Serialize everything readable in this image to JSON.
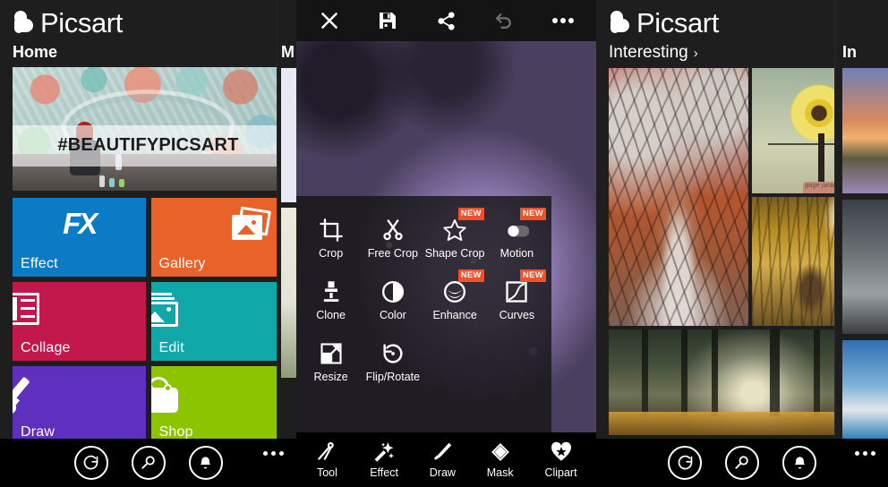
{
  "brand": {
    "name": "Picsart"
  },
  "home": {
    "section_title": "Home",
    "banner": {
      "caption": "#BEAUTIFYPICSART"
    },
    "tiles": [
      {
        "label": "Effect",
        "icon": "fx-icon",
        "color": "#0a7bc4"
      },
      {
        "label": "Gallery",
        "icon": "gallery-icon",
        "color": "#e8622a"
      },
      {
        "label": "Collage",
        "icon": "collage-icon",
        "color": "#c2184b"
      },
      {
        "label": "Edit",
        "icon": "edit-icon",
        "color": "#0fa7a8"
      },
      {
        "label": "Draw",
        "icon": "brush-icon",
        "color": "#5f2fc0"
      },
      {
        "label": "Shop",
        "icon": "shop-bag-icon",
        "color": "#8dc402"
      }
    ],
    "appbar": {
      "refresh": "refresh-icon",
      "search": "search-icon",
      "notifications": "bell-icon",
      "more": "more-dots-icon"
    },
    "peek_panel": {
      "title": "M"
    }
  },
  "editor": {
    "toolbar": [
      {
        "label": "Close",
        "icon": "close-icon",
        "enabled": true
      },
      {
        "label": "Save",
        "icon": "save-icon",
        "enabled": true
      },
      {
        "label": "Share",
        "icon": "share-icon",
        "enabled": true
      },
      {
        "label": "Undo",
        "icon": "undo-icon",
        "enabled": false
      },
      {
        "label": "More",
        "icon": "more-dots-icon",
        "enabled": true
      }
    ],
    "tools": [
      {
        "label": "Crop",
        "icon": "crop-icon",
        "badge": ""
      },
      {
        "label": "Free Crop",
        "icon": "scissors-icon",
        "badge": ""
      },
      {
        "label": "Shape Crop",
        "icon": "star-shape-icon",
        "badge": "NEW"
      },
      {
        "label": "Motion",
        "icon": "motion-icon",
        "badge": "NEW"
      },
      {
        "label": "Clone",
        "icon": "stamp-icon",
        "badge": ""
      },
      {
        "label": "Color",
        "icon": "contrast-icon",
        "badge": ""
      },
      {
        "label": "Enhance",
        "icon": "enhance-icon",
        "badge": "NEW"
      },
      {
        "label": "Curves",
        "icon": "curves-icon",
        "badge": "NEW"
      },
      {
        "label": "Resize",
        "icon": "resize-icon",
        "badge": ""
      },
      {
        "label": "Flip/Rotate",
        "icon": "rotate-icon",
        "badge": ""
      }
    ],
    "bottom_nav": [
      {
        "label": "Tool",
        "icon": "compass-tool-icon"
      },
      {
        "label": "Effect",
        "icon": "magic-wand-icon"
      },
      {
        "label": "Draw",
        "icon": "brush-icon"
      },
      {
        "label": "Mask",
        "icon": "diamond-mask-icon"
      },
      {
        "label": "Clipart",
        "icon": "heart-star-icon"
      }
    ],
    "badge_color": "#f1512a"
  },
  "feed": {
    "section_title": "Interesting",
    "chevron": "›",
    "photos": [
      {
        "name": "autumn-path-photo",
        "signature": ""
      },
      {
        "name": "sunflower-tree-photo",
        "signature": "gage jarah | photography"
      },
      {
        "name": "golden-tunnel-photo",
        "signature": ""
      },
      {
        "name": "misty-forest-photo",
        "signature": ""
      }
    ],
    "appbar": {
      "refresh": "refresh-icon",
      "search": "search-icon",
      "notifications": "bell-icon",
      "more": "more-dots-icon"
    },
    "peek_panel": {
      "title": "In"
    }
  }
}
